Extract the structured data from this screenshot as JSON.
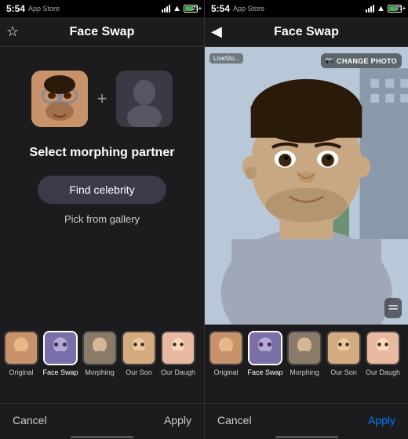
{
  "left": {
    "status": {
      "time": "5:54",
      "app_store": "App Store"
    },
    "nav": {
      "title": "Face Swap",
      "star_icon": "☆"
    },
    "morphing": {
      "select_label": "Select morphing partner",
      "find_celebrity": "Find celebrity",
      "pick_gallery": "Pick from gallery"
    },
    "filters": [
      {
        "label": "Original",
        "selected": false
      },
      {
        "label": "Face Swap",
        "selected": true
      },
      {
        "label": "Morphing",
        "selected": false
      },
      {
        "label": "Our Son",
        "selected": false
      },
      {
        "label": "Our Daugh",
        "selected": false
      }
    ],
    "actions": {
      "cancel": "Cancel",
      "apply": "Apply"
    }
  },
  "right": {
    "status": {
      "time": "5:54",
      "app_store": "App Store"
    },
    "nav": {
      "title": "Face Swap",
      "back_icon": "◀"
    },
    "photo": {
      "change_photo": "CHANGE PHOTO",
      "livestory": "LiveSto..."
    },
    "filters": [
      {
        "label": "Original",
        "selected": false
      },
      {
        "label": "Face Swap",
        "selected": true
      },
      {
        "label": "Morphing",
        "selected": false
      },
      {
        "label": "Our Son",
        "selected": false
      },
      {
        "label": "Our Daugh",
        "selected": false
      }
    ],
    "actions": {
      "cancel": "Cancel",
      "apply": "Apply"
    }
  }
}
